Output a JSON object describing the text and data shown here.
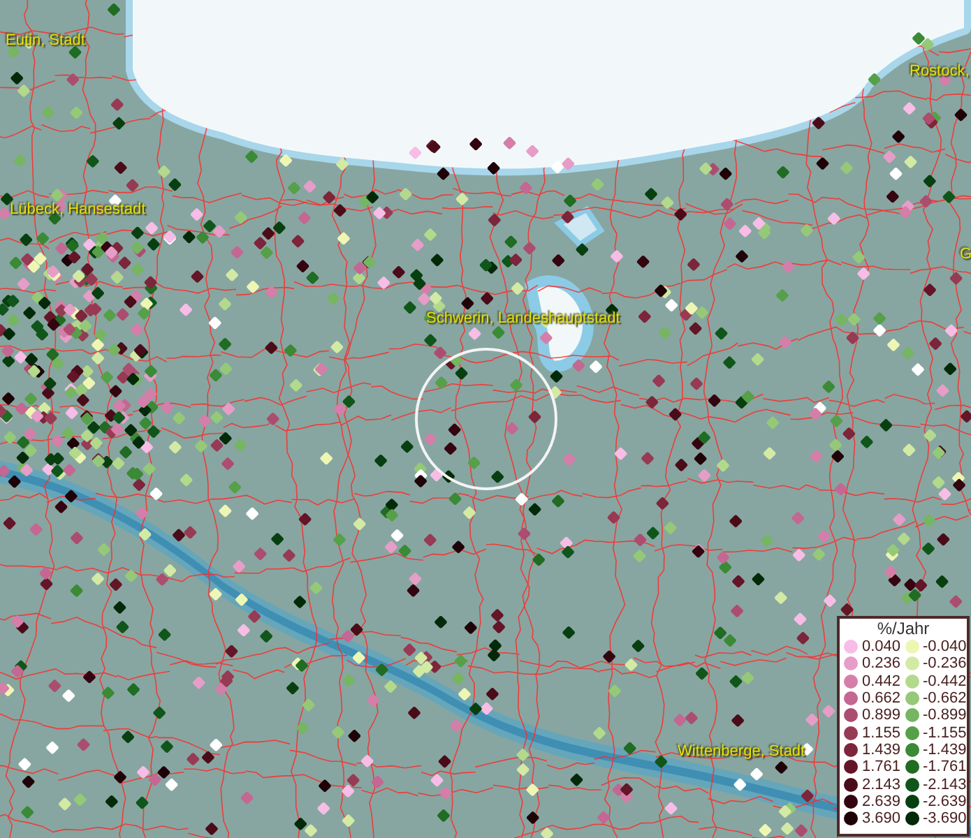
{
  "map": {
    "places": [
      {
        "name": "Eutin, Stadt"
      },
      {
        "name": "Rostock,"
      },
      {
        "name": "Lübeck, Hansestadt"
      },
      {
        "name": "G"
      },
      {
        "name": "Schwerin, Landeshauptstadt"
      },
      {
        "name": "Wittenberge, Stadt"
      }
    ]
  },
  "legend": {
    "title": "%/Jahr",
    "items": [
      {
        "label": "0.040",
        "color": "#f7bde6"
      },
      {
        "label": "-0.040",
        "color": "#eef6b4"
      },
      {
        "label": "0.236",
        "color": "#e69dc8"
      },
      {
        "label": "-0.236",
        "color": "#d2eaa4"
      },
      {
        "label": "0.442",
        "color": "#d47ea9"
      },
      {
        "label": "-0.442",
        "color": "#b3d98c"
      },
      {
        "label": "0.662",
        "color": "#c46792"
      },
      {
        "label": "-0.662",
        "color": "#95c978"
      },
      {
        "label": "0.899",
        "color": "#ac4d70"
      },
      {
        "label": "-0.899",
        "color": "#76b562"
      },
      {
        "label": "1.155",
        "color": "#973a54"
      },
      {
        "label": "-1.155",
        "color": "#56a049"
      },
      {
        "label": "1.439",
        "color": "#7d253a"
      },
      {
        "label": "-1.439",
        "color": "#3a8a36"
      },
      {
        "label": "1.761",
        "color": "#641527"
      },
      {
        "label": "-1.761",
        "color": "#1f6c22"
      },
      {
        "label": "2.143",
        "color": "#4b0c19"
      },
      {
        "label": "-2.143",
        "color": "#10561a"
      },
      {
        "label": "2.639",
        "color": "#340510"
      },
      {
        "label": "-2.639",
        "color": "#083f10"
      },
      {
        "label": "3.690",
        "color": "#1f0208"
      },
      {
        "label": "-3.690",
        "color": "#032a08"
      }
    ]
  }
}
